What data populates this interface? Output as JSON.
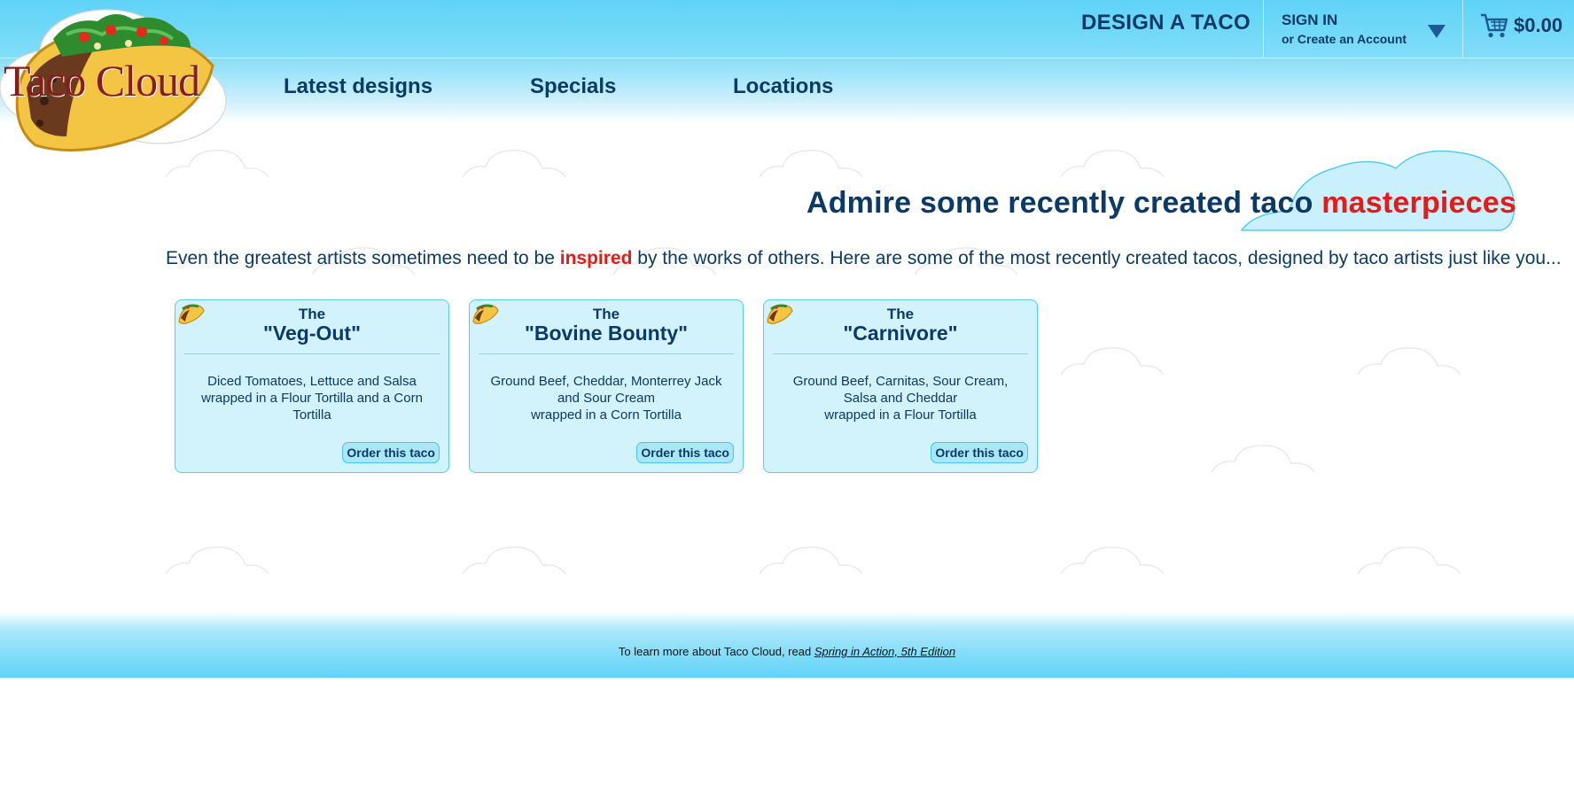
{
  "brand": {
    "logo_text": "Taco Cloud"
  },
  "header": {
    "design_link": "DESIGN A TACO",
    "sign_in": "SIGN IN",
    "create_account": "or Create an Account",
    "cart_total": "$0.00"
  },
  "nav": {
    "items": [
      {
        "label": "Latest designs"
      },
      {
        "label": "Specials"
      },
      {
        "label": "Locations"
      }
    ]
  },
  "main": {
    "heading_prefix": "Admire some recently created taco",
    "heading_highlight": "masterpieces",
    "intro_before": "Even the greatest artists sometimes need to be",
    "intro_highlight": "inspired",
    "intro_after": "by the works of others. Here are some of the most recently created tacos, designed by taco artists just like you...",
    "tacos": [
      {
        "the": "The",
        "name": "\"Veg-Out\"",
        "ingredients": [
          "Diced Tomatoes, Lettuce and Salsa",
          "wrapped in a Flour Tortilla and a Corn",
          "Tortilla"
        ],
        "order_label": "Order this taco"
      },
      {
        "the": "The",
        "name": "\"Bovine Bounty\"",
        "ingredients": [
          "Ground Beef, Cheddar, Monterrey Jack",
          "and Sour Cream",
          "wrapped in a Corn Tortilla"
        ],
        "order_label": "Order this taco"
      },
      {
        "the": "The",
        "name": "\"Carnivore\"",
        "ingredients": [
          "Ground Beef, Carnitas, Sour Cream,",
          "Salsa and Cheddar",
          "wrapped in a Flour Tortilla"
        ],
        "order_label": "Order this taco"
      }
    ]
  },
  "footer": {
    "text": "To learn more about Taco Cloud, read",
    "link": "Spring in Action, 5th Edition"
  },
  "colors": {
    "sky": "#5fd3f7",
    "navy": "#0b3a66",
    "accent_red": "#e41b17",
    "card_bg": "#d2f2fc"
  }
}
